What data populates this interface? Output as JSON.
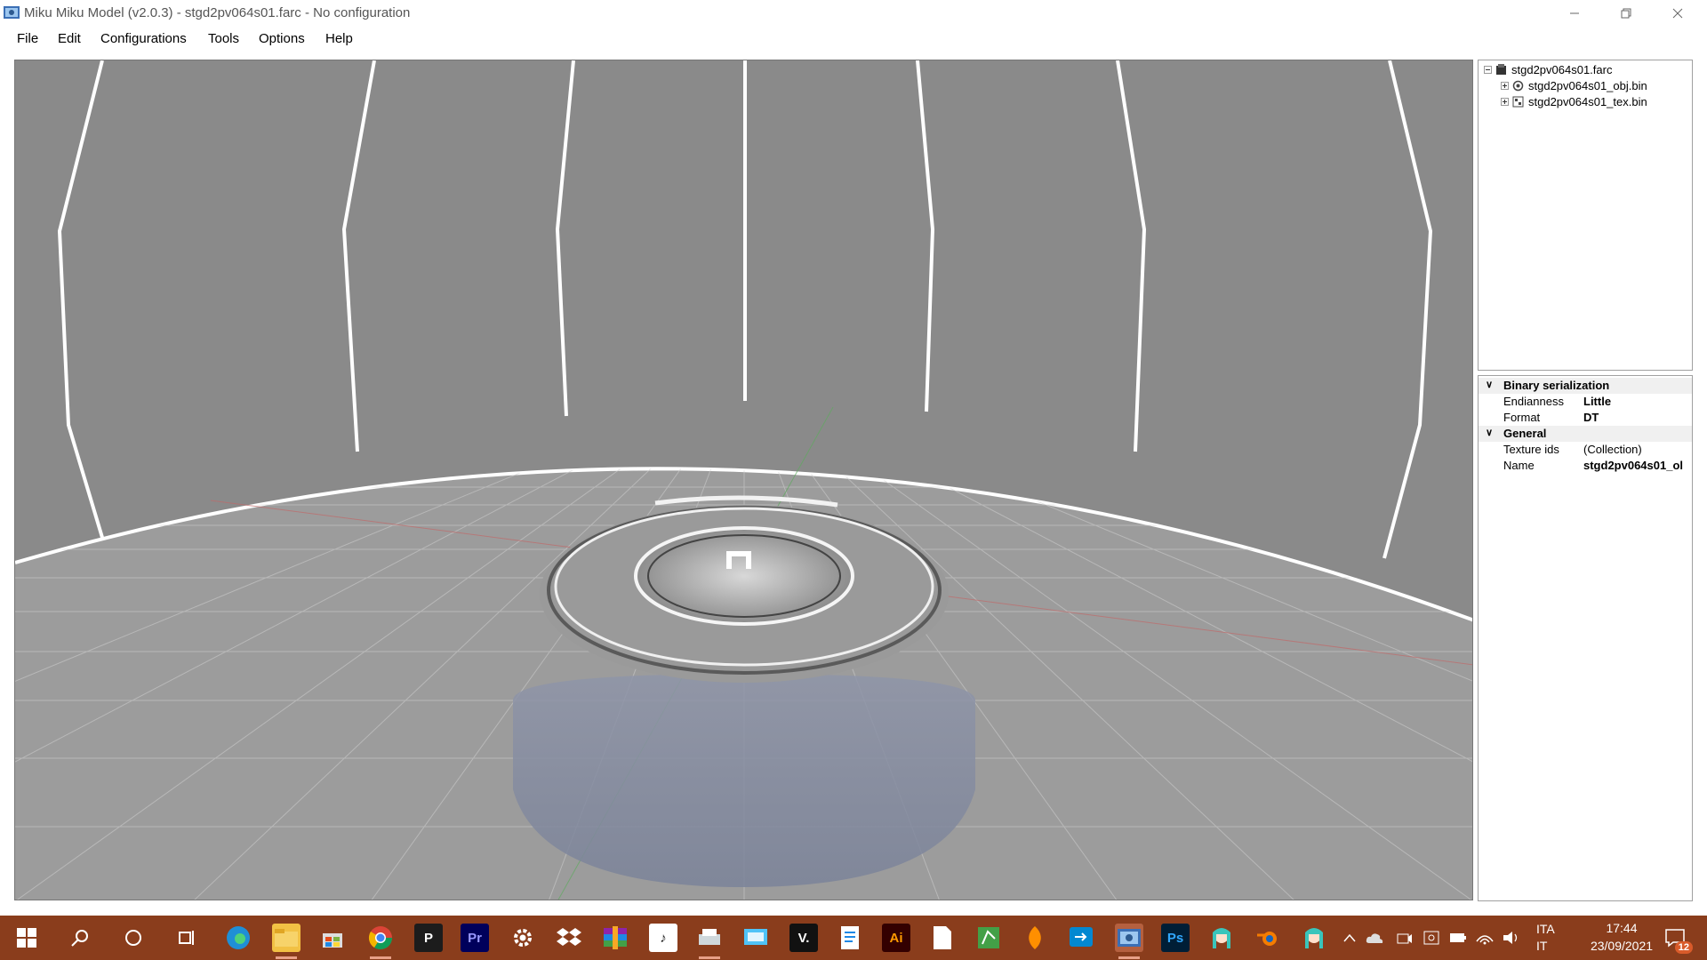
{
  "window": {
    "title": "Miku Miku Model (v2.0.3) - stgd2pv064s01.farc - No configuration",
    "controls": [
      "minimize",
      "restore",
      "close"
    ]
  },
  "menu": [
    "File",
    "Edit",
    "Configurations",
    "Tools",
    "Options",
    "Help"
  ],
  "tree": {
    "root": "stgd2pv064s01.farc",
    "children": [
      "stgd2pv064s01_obj.bin",
      "stgd2pv064s01_tex.bin"
    ]
  },
  "properties": {
    "categories": [
      {
        "name": "Binary serialization",
        "rows": [
          {
            "key": "Endianness",
            "value": "Little"
          },
          {
            "key": "Format",
            "value": "DT"
          }
        ]
      },
      {
        "name": "General",
        "rows": [
          {
            "key": "Texture ids",
            "value": "(Collection)"
          },
          {
            "key": "Name",
            "value": "stgd2pv064s01_ol"
          }
        ]
      }
    ]
  },
  "taskbar": {
    "icons": [
      "windows-start-icon",
      "search-icon",
      "cortana-icon",
      "task-view-icon",
      "edge-icon",
      "file-explorer-icon",
      "store-icon",
      "chrome-icon",
      "p-app-icon",
      "premiere-icon",
      "settings-icon",
      "dropbox-icon",
      "winrar-icon",
      "music-app-icon",
      "printer-icon",
      "monitor-app-icon",
      "v-app-icon",
      "document-icon",
      "illustrator-icon",
      "blank-file-icon",
      "maps-app-icon",
      "fl-studio-icon",
      "remote-app-icon",
      "miku-miku-model-icon",
      "photoshop-icon",
      "miku-icon",
      "blender-icon",
      "miku-icon-2"
    ],
    "labels": {
      "premiere": "Pr",
      "v_app": "V.",
      "illustrator": "Ai",
      "photoshop": "Ps",
      "p_app": "P"
    },
    "language": {
      "line1": "ITA",
      "line2": "IT"
    },
    "clock": {
      "time": "17:44",
      "date": "23/09/2021"
    },
    "notifications": "12"
  },
  "colors": {
    "taskbar": "#8a3d1c",
    "viewport": "#8b8b8b",
    "accent": "#d95b2a"
  }
}
